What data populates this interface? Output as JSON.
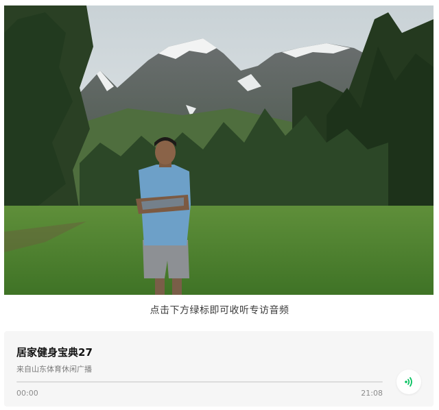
{
  "caption": "点击下方绿标即可收听专访音频",
  "audio": {
    "title": "居家健身宝典27",
    "source": "来自山东体育休闲广播",
    "current_time": "00:00",
    "total_time": "21:08",
    "progress": 0,
    "play_icon": "audio-wave-icon",
    "accent_color": "#07c160"
  }
}
